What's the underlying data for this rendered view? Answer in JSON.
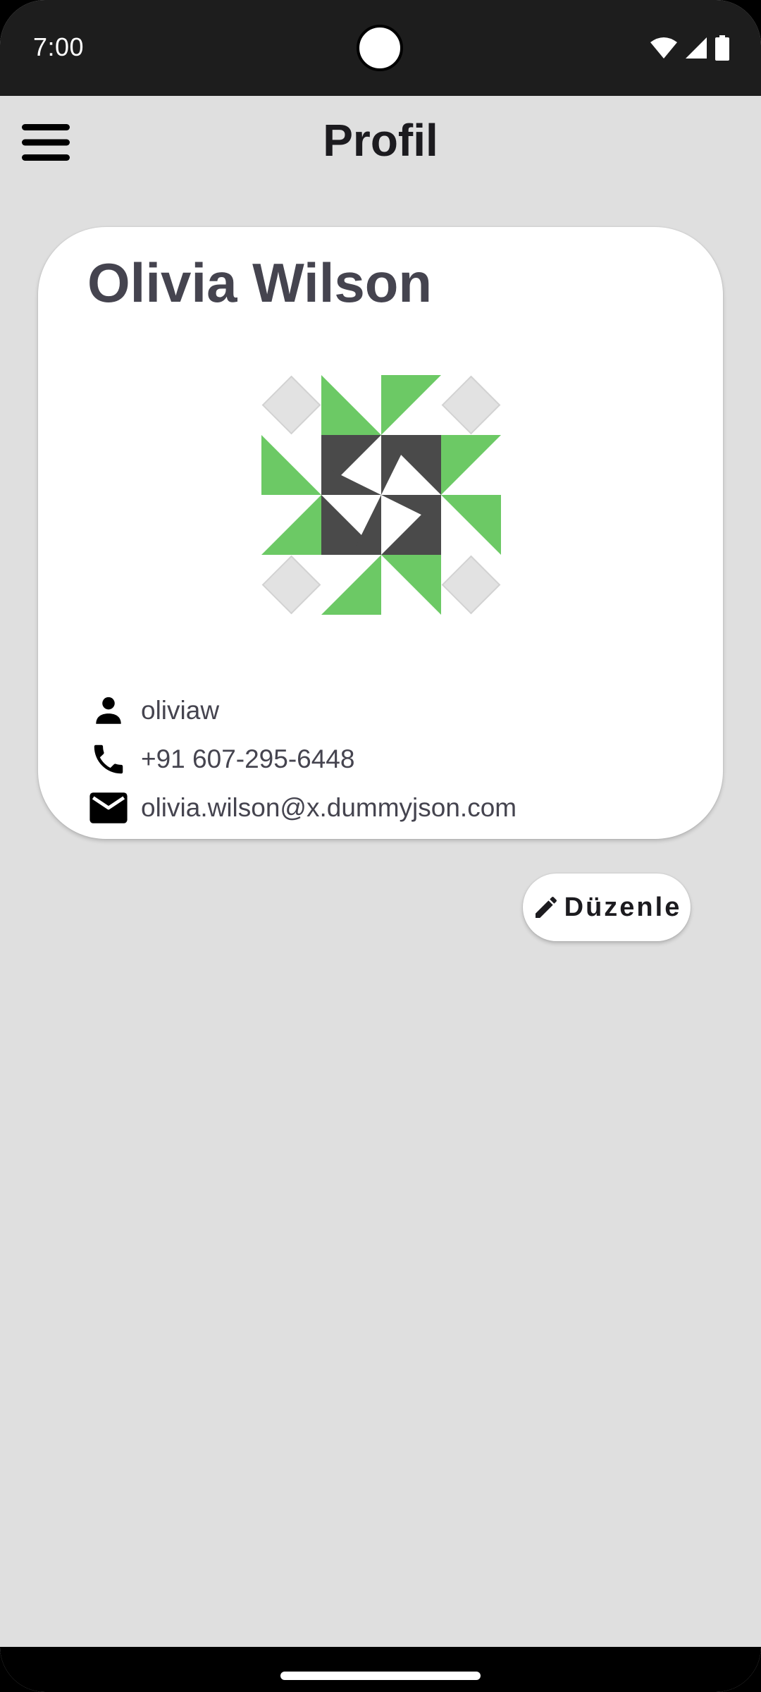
{
  "status_bar": {
    "time": "7:00",
    "icons": [
      "wifi-icon",
      "cellular-signal-icon",
      "battery-icon"
    ]
  },
  "app_bar": {
    "title": "Profil",
    "menu_icon": "hamburger-menu-icon"
  },
  "profile": {
    "name": "Olivia Wilson",
    "avatar": "identicon-avatar",
    "username": "oliviaw",
    "phone": "+91 607-295-6448",
    "email": "olivia.wilson@x.dummyjson.com"
  },
  "actions": {
    "edit_label": "Düzenle",
    "edit_icon": "pencil-icon"
  },
  "colors": {
    "background": "#dfdfdf",
    "status_bar": "#1d1d1d",
    "card": "#ffffff",
    "text_primary": "#45444f",
    "title_text": "#1c1b1f",
    "avatar_green": "#6cc965",
    "avatar_dark": "#4a4a4a",
    "avatar_light": "#e2e2e2"
  }
}
